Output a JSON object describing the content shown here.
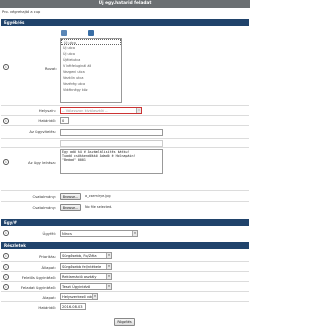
{
  "window": {
    "title": "Új egy.hatarid feladat",
    "subtitle": "Pro. végrehajtó a cup"
  },
  "sections": {
    "general": "Egyéb/és",
    "copy": "Egy/#",
    "details": "Részletek"
  },
  "general": {
    "icons_label": "Rovat:",
    "tabs": [
      "0",
      "0"
    ],
    "list": [
      "Új utca",
      "Új utca",
      "Új utca",
      "Újéletutca",
      "V kétfeluginál áll",
      "Vezgeni utca",
      "Vezklin utca",
      "Vezérég utca",
      "Vidéknégy köz"
    ],
    "select_label": "Helyszín:",
    "select_placeholder": "-- Válasszon kiválasztót --",
    "priority_label": "Határidő:",
    "priority_value": "0",
    "subject_label": "Az ügyvitelés:",
    "body_label": "Az ügy leírása:",
    "body_text": "Egy adó kü é Aszámlálisítés kátku!\nTuadó csökkendőkkö Adadó é Holnapáin!\n\"Beáad\" 0001",
    "file1_label": "Csatolmány:",
    "file1_button": "Browse...",
    "file1_name": "a_csemirye.jpg",
    "file2_label": "Csatolmány:",
    "file2_button": "Browse...",
    "file2_name": "No file selected."
  },
  "copy": {
    "label": "Ügyfél:",
    "value": "Nincs"
  },
  "details": {
    "rows": [
      {
        "label": "Prioritás:",
        "value": "Sürgősebb, Fo/Zéla"
      },
      {
        "label": "Állapot:",
        "value": "Sürgősebb fel/ntékele"
      },
      {
        "label": "Felelős ügyintéző:",
        "value": "Reklamáció osztály"
      },
      {
        "label": "Feladat ügyintéző:",
        "value": "Teszt Ügyintéző"
      },
      {
        "label": "Alapot:",
        "value": "Helyszerkező vár"
      },
      {
        "label": "Határidő:",
        "value": "2016.08.03"
      }
    ],
    "submit": "Rögzítés"
  }
}
